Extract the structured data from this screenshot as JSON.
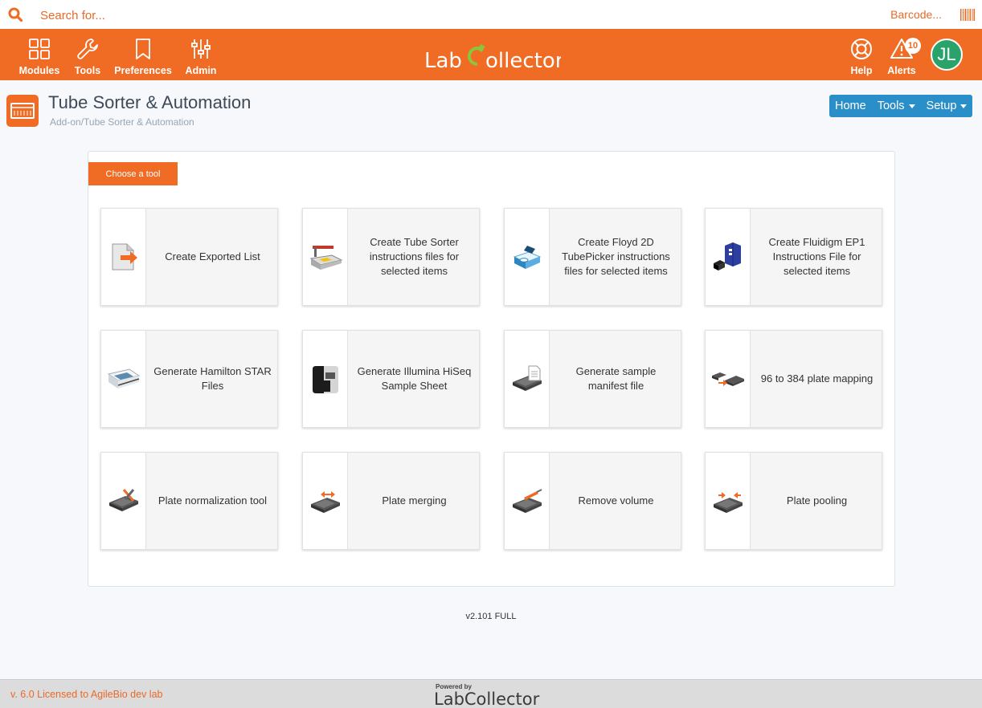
{
  "search": {
    "placeholder": "Search for...",
    "barcode_label": "Barcode..."
  },
  "nav": {
    "left": [
      {
        "label": "Modules",
        "icon": "grid-icon"
      },
      {
        "label": "Tools",
        "icon": "wrench-icon"
      },
      {
        "label": "Preferences",
        "icon": "bookmark-icon"
      },
      {
        "label": "Admin",
        "icon": "sliders-icon"
      }
    ],
    "logo": {
      "part1": "Lab",
      "part2": "ollector"
    },
    "right": [
      {
        "label": "Help",
        "icon": "lifebuoy-icon"
      },
      {
        "label": "Alerts",
        "icon": "warning-icon",
        "badge": "10"
      }
    ],
    "avatar_initials": "JL"
  },
  "page": {
    "title": "Tube Sorter & Automation",
    "breadcrumb": "Add-on/Tube Sorter & Automation",
    "buttons": {
      "home": "Home",
      "tools": "Tools",
      "setup": "Setup"
    }
  },
  "panel": {
    "tab_label": "Choose a tool",
    "cards": [
      {
        "label": "Create Exported List",
        "icon": "export-file-icon"
      },
      {
        "label": "Create Tube Sorter instructions files for selected items",
        "icon": "tube-sorter-icon"
      },
      {
        "label": "Create Floyd 2D TubePicker instructions files for selected items",
        "icon": "tubepicker-icon"
      },
      {
        "label": "Create Fluidigm EP1 Instructions File for selected items",
        "icon": "fluidigm-icon"
      },
      {
        "label": "Generate Hamilton STAR Files",
        "icon": "hamilton-icon"
      },
      {
        "label": "Generate Illumina HiSeq Sample Sheet",
        "icon": "illumina-icon"
      },
      {
        "label": "Generate sample manifest file",
        "icon": "manifest-icon"
      },
      {
        "label": "96 to 384 plate mapping",
        "icon": "plate-mapping-icon"
      },
      {
        "label": "Plate normalization tool",
        "icon": "normalization-icon"
      },
      {
        "label": "Plate merging",
        "icon": "plate-merge-icon"
      },
      {
        "label": "Remove volume",
        "icon": "remove-volume-icon"
      },
      {
        "label": "Plate pooling",
        "icon": "plate-pool-icon"
      }
    ]
  },
  "version": "v2.101 FULL",
  "footer": {
    "license": "v. 6.0 Licensed to AgileBio dev lab",
    "powered_by": "Powered by",
    "logo": "LabCollector"
  },
  "colors": {
    "brand": "#f06b23",
    "accent": "#2a8fc9",
    "avatar": "#2aa36a"
  }
}
